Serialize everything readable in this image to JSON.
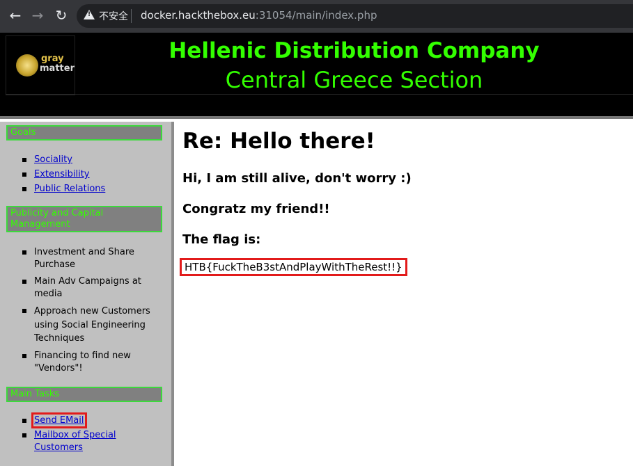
{
  "browser": {
    "back_icon": "←",
    "forward_icon": "→",
    "reload_icon": "↻",
    "security_label": "不安全",
    "url_host": "docker.hackthebox.eu",
    "url_rest": ":31054/main/index.php"
  },
  "header": {
    "logo_top": "gray",
    "logo_bottom": "matter",
    "company": "Hellenic Distribution Company",
    "section": "Central Greece Section"
  },
  "sidebar": {
    "goals_title": "Goals",
    "goals": [
      "Sociality",
      "Extensibility",
      "Public Relations"
    ],
    "publicity_title": "Publicity and Capital Management",
    "publicity": [
      "Investment and Share Purchase",
      "Main Adv Campaigns at media",
      "Approach new Customers using Social Engineering Techniques",
      "Financing to find new \"Vendors\"!"
    ],
    "tasks_title": "Main Tasks",
    "tasks": [
      "Send EMail",
      "Mailbox of Special Customers"
    ]
  },
  "main": {
    "title": "Re: Hello there!",
    "line1": "Hi, I am still alive, don't worry :)",
    "line2": "Congratz my friend!!",
    "line3": "The flag is:",
    "flag": "HTB{FuckTheB3stAndPlayWithTheRest!!}"
  },
  "colors": {
    "accent_green": "#33ff00",
    "highlight_red": "#e21b1b"
  }
}
